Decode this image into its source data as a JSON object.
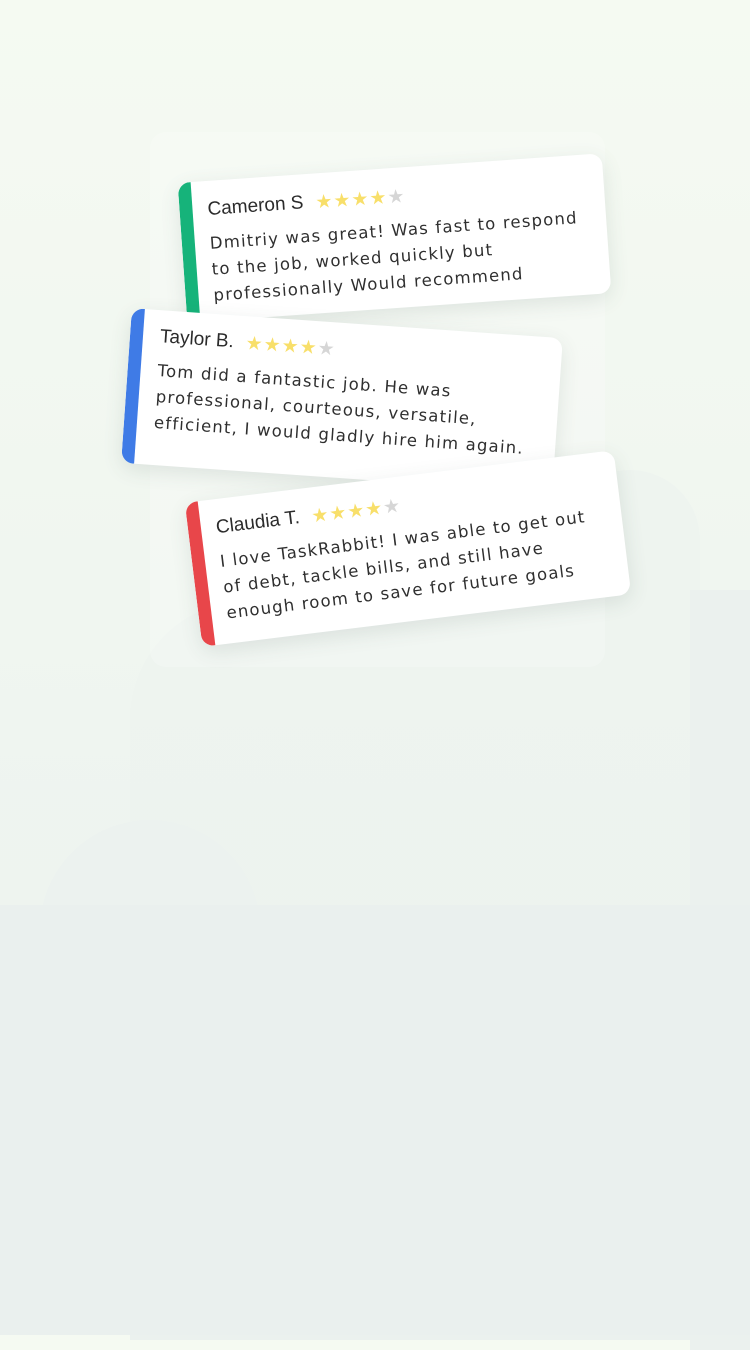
{
  "reviews": [
    {
      "name": "Cameron S",
      "rating": 4,
      "max_rating": 5,
      "text": "Dmitriy was great! Was fast to respond to the job, worked quickly but professionally Would recommend",
      "accent_color": "#16b37a"
    },
    {
      "name": "Taylor B.",
      "rating": 4,
      "max_rating": 5,
      "text": "Tom did a fantastic job. He was professional, courteous, versatile, efficient, I would gladly hire him again.",
      "accent_color": "#3f7be6"
    },
    {
      "name": "Claudia T.",
      "rating": 4,
      "max_rating": 5,
      "text": "I love TaskRabbit! I was able to get out of debt, tackle bills, and still have enough room to save for future goals",
      "accent_color": "#e8464a"
    }
  ],
  "star_icons": {
    "full": "★",
    "empty": "★"
  },
  "colors": {
    "star_full": "#f8df6a",
    "star_empty": "#d6d6d6",
    "background": "#f2f7f1"
  }
}
